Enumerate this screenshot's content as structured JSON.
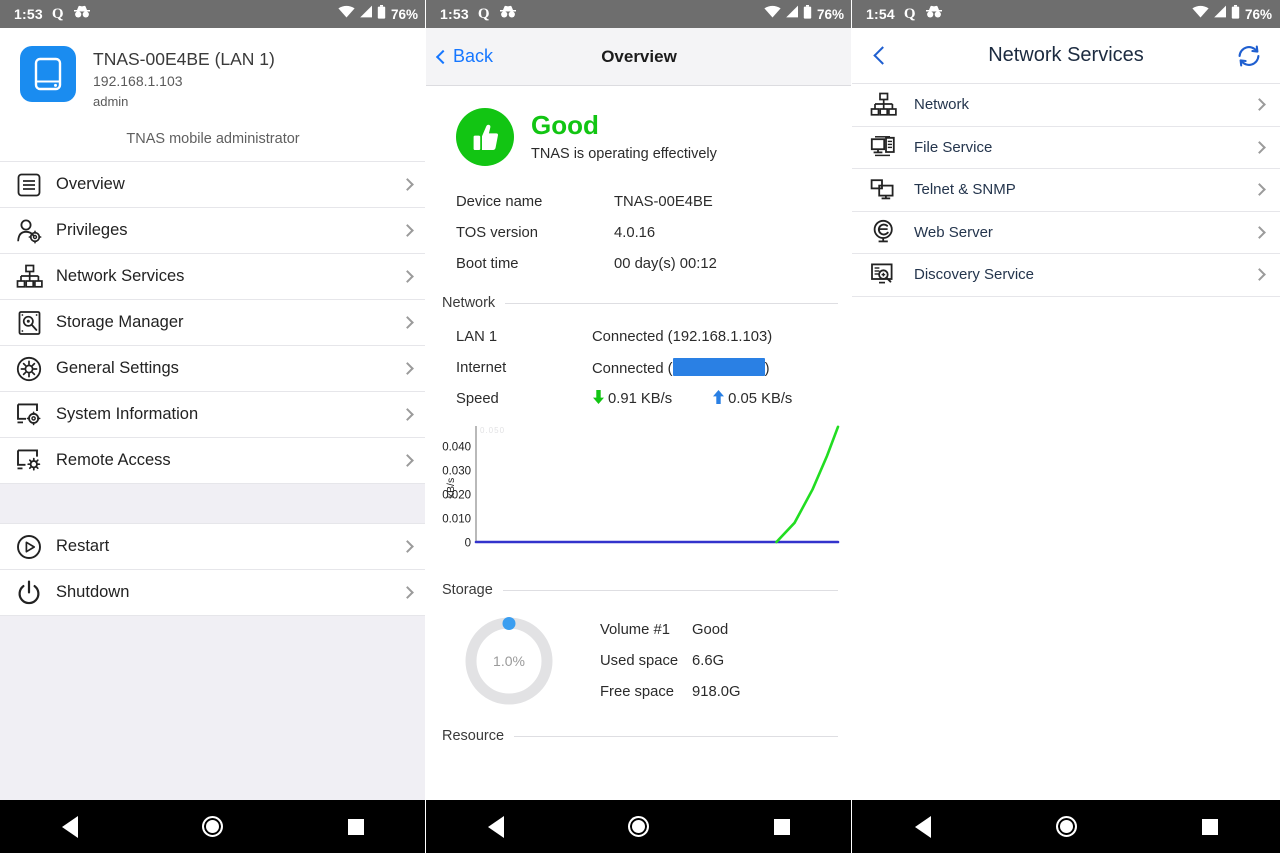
{
  "statusbar": {
    "time_left": "1:53",
    "time_right": "1:54",
    "q_icon": "q-app-icon",
    "incognito_icon": "incognito-icon",
    "wifi_icon": "wifi-icon",
    "signal_icon": "cellular-signal-icon",
    "battery_icon": "battery-icon",
    "battery_pct": "76%"
  },
  "navbar": {
    "back": "nav-back-triangle",
    "home": "nav-home-circle",
    "recents": "nav-recents-square"
  },
  "menu_panel": {
    "device": {
      "icon": "nas-drive-icon",
      "name": "TNAS-00E4BE (LAN 1)",
      "ip": "192.168.1.103",
      "user": "admin"
    },
    "subtitle": "TNAS mobile administrator",
    "items": [
      {
        "label": "Overview",
        "icon": "list-overview-icon"
      },
      {
        "label": "Privileges",
        "icon": "user-gear-icon"
      },
      {
        "label": "Network Services",
        "icon": "network-tree-icon"
      },
      {
        "label": "Storage Manager",
        "icon": "hard-drive-search-icon"
      },
      {
        "label": "General Settings",
        "icon": "gear-circle-icon"
      },
      {
        "label": "System Information",
        "icon": "monitor-gear-icon"
      },
      {
        "label": "Remote Access",
        "icon": "monitor-remote-icon"
      }
    ],
    "power_items": [
      {
        "label": "Restart",
        "icon": "restart-play-circle-icon"
      },
      {
        "label": "Shutdown",
        "icon": "power-icon"
      }
    ],
    "chevron_icon": "chevron-right-icon"
  },
  "overview_panel": {
    "header": {
      "back_label": "Back",
      "back_icon": "chevron-left-icon",
      "title": "Overview"
    },
    "health": {
      "icon": "thumbs-up-icon",
      "status": "Good",
      "message": "TNAS is operating effectively",
      "color": "#12c513"
    },
    "info": [
      {
        "key": "Device name",
        "value": "TNAS-00E4BE"
      },
      {
        "key": "TOS version",
        "value": "4.0.16"
      },
      {
        "key": "Boot time",
        "value": "00 day(s) 00:12"
      }
    ],
    "network": {
      "section_title": "Network",
      "lan_key": "LAN 1",
      "lan_value": "Connected (192.168.1.103)",
      "internet_key": "Internet",
      "internet_value_prefix": "Connected (",
      "internet_value_suffix": ")",
      "internet_redacted": true,
      "speed_key": "Speed",
      "download_icon": "arrow-down-icon",
      "download_value": "0.91 KB/s",
      "download_color": "#12c513",
      "upload_icon": "arrow-up-icon",
      "upload_value": "0.05 KB/s",
      "upload_color": "#2a80e4"
    },
    "storage": {
      "section_title": "Storage",
      "percent_label": "1.0%",
      "rows": [
        {
          "key": "Volume #1",
          "value": "Good"
        },
        {
          "key": "Used space",
          "value": "6.6G"
        },
        {
          "key": "Free space",
          "value": "918.0G"
        }
      ],
      "ring_color": "#e2e2e4",
      "marker_color": "#3b9ef0"
    },
    "resource": {
      "section_title": "Resource"
    }
  },
  "services_panel": {
    "header": {
      "back_icon": "chevron-left-icon",
      "title": "Network Services",
      "refresh_icon": "refresh-icon"
    },
    "items": [
      {
        "label": "Network",
        "icon": "network-tree-icon"
      },
      {
        "label": "File Service",
        "icon": "monitor-document-icon"
      },
      {
        "label": "Telnet & SNMP",
        "icon": "dual-monitor-icon"
      },
      {
        "label": "Web Server",
        "icon": "globe-e-icon"
      },
      {
        "label": "Discovery Service",
        "icon": "monitor-magnifier-icon"
      }
    ],
    "chevron_icon": "chevron-right-icon"
  },
  "chart_data": {
    "type": "line",
    "title": "",
    "xlabel": "",
    "ylabel": "kB/s",
    "ylim": [
      0,
      0.045
    ],
    "yticks": [
      0,
      0.01,
      0.02,
      0.03,
      0.04
    ],
    "ytick_labels": [
      "0",
      "0.010",
      "0.020",
      "0.030",
      "0.040"
    ],
    "grid": false,
    "legend": "none",
    "series": [
      {
        "name": "upload",
        "color": "#3333cc",
        "x": [
          0,
          0.2,
          0.4,
          0.6,
          0.8,
          0.9,
          0.95,
          1.0
        ],
        "values": [
          0,
          0,
          0,
          0,
          0,
          0,
          0,
          0
        ]
      },
      {
        "name": "download",
        "color": "#22dd22",
        "x": [
          0.83,
          0.88,
          0.93,
          0.97,
          1.0
        ],
        "values": [
          0,
          0.008,
          0.022,
          0.036,
          0.048
        ]
      }
    ]
  }
}
